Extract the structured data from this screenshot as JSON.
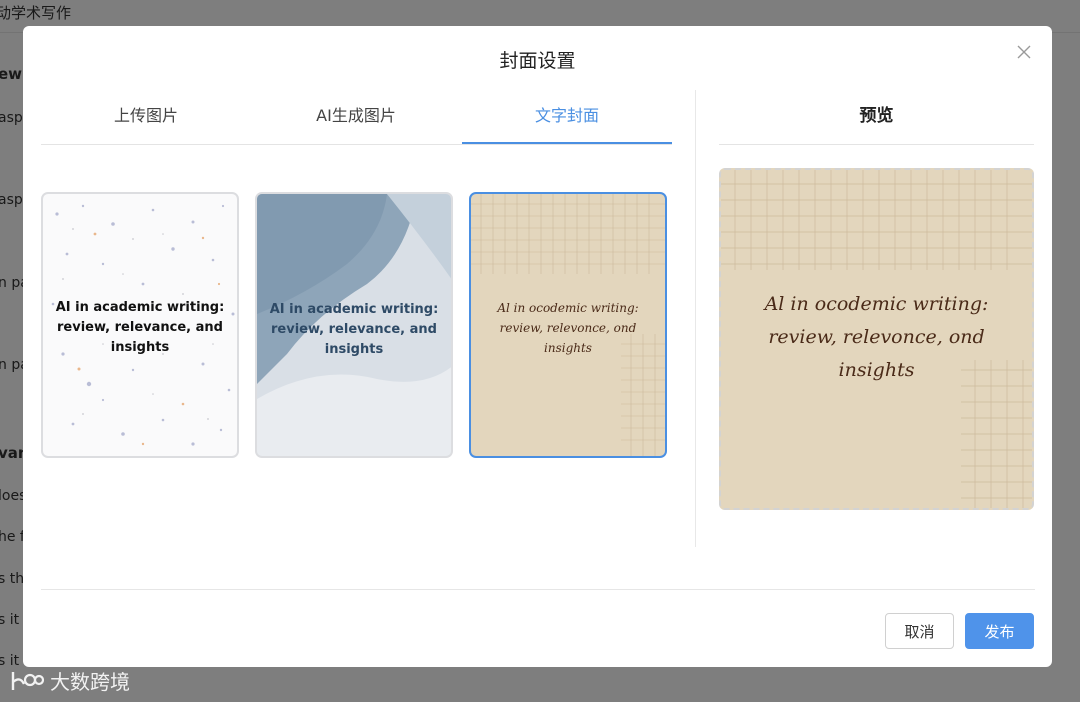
{
  "background": {
    "title": "动学术写作",
    "fragments": [
      "ew a",
      "asp",
      "asp",
      "n pa",
      "n pa",
      "van",
      "loes",
      "he f",
      "s th",
      "s it",
      "s it"
    ]
  },
  "watermark": {
    "logo": "\\b",
    "text": "大数跨境"
  },
  "dialog": {
    "title": "封面设置",
    "tabs": [
      {
        "label": "上传图片",
        "active": false
      },
      {
        "label": "AI生成图片",
        "active": false
      },
      {
        "label": "文字封面",
        "active": true
      }
    ],
    "cover_text": "AI in academic writing: review, relevance, and insights",
    "cover_text_script": "Al in ocodemic writing: review, relevonce, ond insights",
    "templates": [
      {
        "name": "terrazzo",
        "selected": false
      },
      {
        "name": "watercolor-blue",
        "selected": false
      },
      {
        "name": "vintage-paper",
        "selected": true
      }
    ],
    "preview": {
      "title": "预览"
    },
    "buttons": {
      "cancel": "取消",
      "publish": "发布"
    }
  },
  "colors": {
    "accent": "#4a8fe2",
    "publish_bg": "#4f93ea",
    "paper": "#e3d6bd",
    "ink": "#4a2a18"
  }
}
